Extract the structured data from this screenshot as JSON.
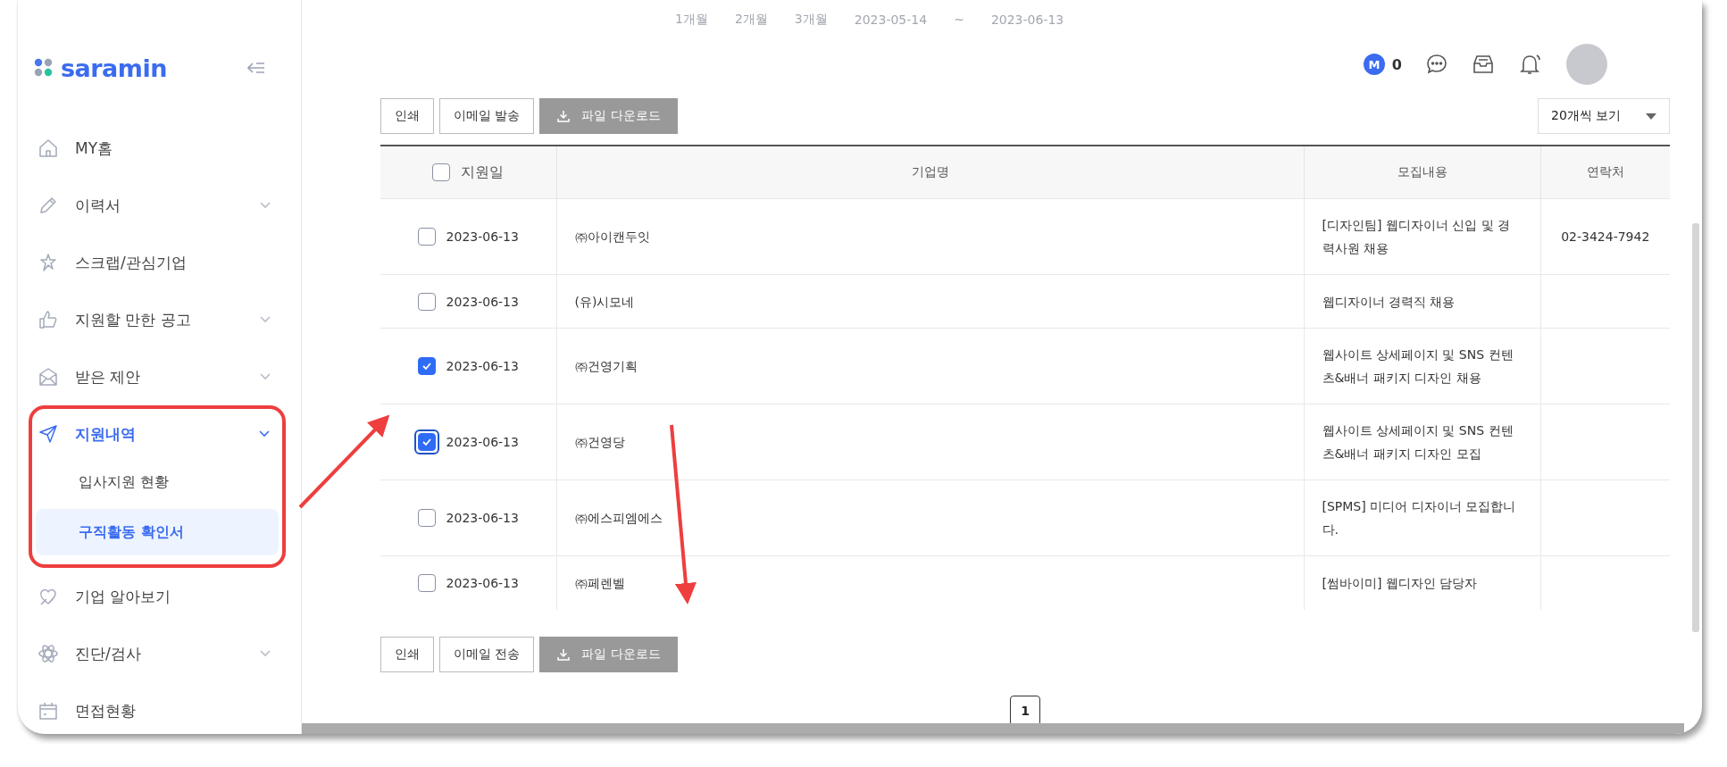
{
  "filter_bar": {
    "periods": [
      "1개월",
      "2개월",
      "3개월"
    ],
    "start_date": "2023-05-14",
    "separator": "~",
    "end_date": "2023-06-13"
  },
  "sidebar": {
    "logo": "saramin",
    "items": [
      {
        "label": "MY홈",
        "has_chevron": false,
        "active": false
      },
      {
        "label": "이력서",
        "has_chevron": true,
        "active": false
      },
      {
        "label": "스크랩/관심기업",
        "has_chevron": false,
        "active": false
      },
      {
        "label": "지원할 만한 공고",
        "has_chevron": true,
        "active": false
      },
      {
        "label": "받은 제안",
        "has_chevron": true,
        "active": false
      },
      {
        "label": "지원내역",
        "has_chevron": true,
        "active": true,
        "highlighted": true,
        "children": [
          {
            "label": "입사지원 현황",
            "selected": false
          },
          {
            "label": "구직활동 확인서",
            "selected": true
          }
        ]
      },
      {
        "label": "기업 알아보기",
        "has_chevron": false,
        "active": false
      },
      {
        "label": "진단/검사",
        "has_chevron": true,
        "active": false
      },
      {
        "label": "면접현황",
        "has_chevron": false,
        "active": false
      }
    ]
  },
  "header": {
    "points_badge": "M",
    "points": "0"
  },
  "top_toolbar": {
    "buttons": [
      {
        "label": "인쇄",
        "kind": "outline"
      },
      {
        "label": "이메일 발송",
        "kind": "outline"
      },
      {
        "label": "파일 다운로드",
        "kind": "download"
      }
    ],
    "page_size": "20개씩 보기"
  },
  "table": {
    "columns": [
      "지원일",
      "기업명",
      "모집내용",
      "연락처"
    ],
    "select_all_checked": false,
    "rows": [
      {
        "checked": false,
        "focused": false,
        "date": "2023-06-13",
        "company": "㈜아이캔두잇",
        "recruitment": "[디자인팀] 웹디자이너 신입 및 경력사원 채용",
        "contact": "02-3424-7942"
      },
      {
        "checked": false,
        "focused": false,
        "date": "2023-06-13",
        "company": "(유)시모네",
        "recruitment": "웹디자이너 경력직 채용"
      },
      {
        "checked": true,
        "focused": false,
        "date": "2023-06-13",
        "company": "㈜건영기획",
        "recruitment": "웹사이트 상세페이지 및 SNS 컨텐츠&배너 패키지 디자인 채용"
      },
      {
        "checked": true,
        "focused": true,
        "date": "2023-06-13",
        "company": "㈜건영당",
        "recruitment": "웹사이트 상세페이지 및 SNS 컨텐츠&배너 패키지 디자인 모집"
      },
      {
        "checked": false,
        "focused": false,
        "date": "2023-06-13",
        "company": "㈜에스피엠에스",
        "recruitment": "[SPMS] 미디어 디자이너 모집합니다."
      },
      {
        "checked": false,
        "focused": false,
        "date": "2023-06-13",
        "company": "㈜페렌벨",
        "recruitment": "[썸바이미] 웹디자인 담당자"
      }
    ]
  },
  "bottom_toolbar": {
    "buttons": [
      {
        "label": "인쇄",
        "kind": "outline"
      },
      {
        "label": "이메일 전송",
        "kind": "outline"
      },
      {
        "label": "파일 다운로드",
        "kind": "download"
      }
    ]
  },
  "pagination": {
    "pages": [
      {
        "label": "1",
        "selected": true
      }
    ]
  }
}
